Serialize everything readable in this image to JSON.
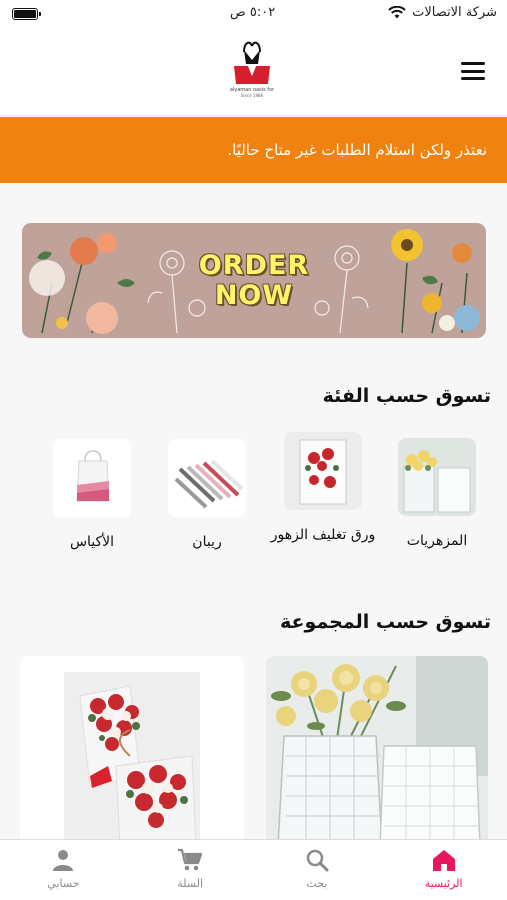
{
  "status_bar": {
    "carrier": "شركة الاتصالات",
    "time": "٥:٠٢ ص"
  },
  "brand": {
    "name": "alyaman oasis for",
    "since": "Since 1986",
    "accent": "#d81e2c"
  },
  "notice": {
    "text": "نعتذر ولكن استلام الطلبات غير متاح حاليًا.",
    "color": "#f0820f"
  },
  "promo": {
    "line1": "ORDER",
    "line2": "NOW"
  },
  "categories_section": {
    "title": "تسوق حسب الفئة",
    "items": [
      {
        "label": "المزهريات",
        "icon": "vase-image"
      },
      {
        "label": "ورق تغليف الزهور",
        "icon": "wrapping-paper-image"
      },
      {
        "label": "ريبان",
        "icon": "ribbon-image"
      },
      {
        "label": "الأكياس",
        "icon": "gift-bag-image"
      }
    ]
  },
  "groups_section": {
    "title": "تسوق حسب المجموعة",
    "items": [
      {
        "icon": "crystal-vases-image"
      },
      {
        "icon": "rose-bouquet-image"
      }
    ]
  },
  "tabbar": {
    "active_color": "#e8175d",
    "items": [
      {
        "label": "الرئيسية",
        "icon": "home-icon"
      },
      {
        "label": "بحث",
        "icon": "search-icon"
      },
      {
        "label": "السلة",
        "icon": "cart-icon"
      },
      {
        "label": "حسابي",
        "icon": "user-icon"
      }
    ]
  }
}
